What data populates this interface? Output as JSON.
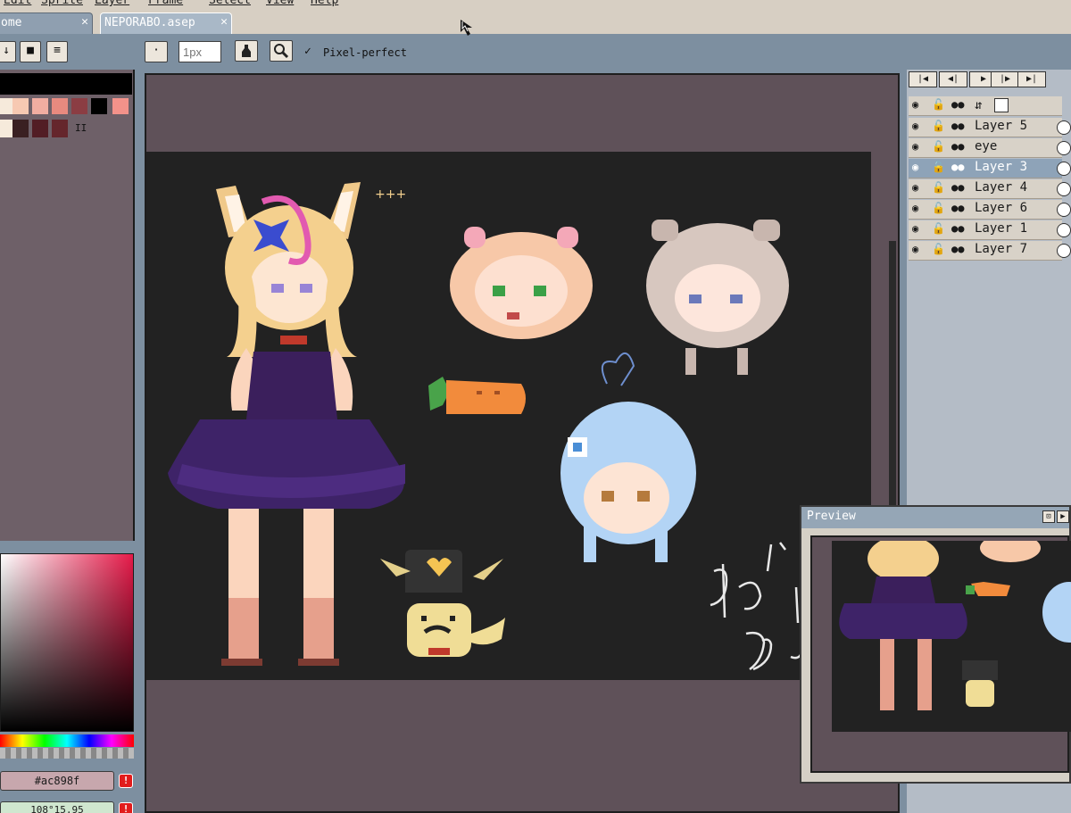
{
  "menu": [
    "Edit",
    "Sprite",
    "Layer",
    "Frame",
    "Select",
    "View",
    "Help"
  ],
  "tabs": [
    {
      "label": "ome",
      "close": "✕"
    },
    {
      "label": "NEPORABO.asep",
      "close": "✕"
    }
  ],
  "left_toolbar": {
    "down": "↓",
    "square": "■",
    "menu": "≡"
  },
  "context_bar": {
    "dot": "·",
    "brush_size_placeholder": "1px",
    "pixel_perfect_check": "✓",
    "pixel_perfect_label": "Pixel-perfect"
  },
  "palette": {
    "colors": [
      "#000000",
      "#f6eadb",
      "#f7c9b2",
      "#f1ada1",
      "#e88a7f",
      "#c0655e",
      "#8b3d43",
      "#000000",
      "#f3928a",
      "#3a2022",
      "#521d25",
      "#65262c",
      "#2b1113",
      "#4b1d22"
    ],
    "more_marker": "II"
  },
  "color_editor": {
    "hex": "#ac898f",
    "hsv": "108°15,95",
    "warning": "!"
  },
  "playback": [
    "|◀",
    "◀|",
    "▶",
    "|▶",
    "▶|"
  ],
  "layers": [
    {
      "name": "Layer 5",
      "selected": false
    },
    {
      "name": "eye",
      "selected": false
    },
    {
      "name": "Layer 3",
      "selected": true
    },
    {
      "name": "Layer 4",
      "selected": false
    },
    {
      "name": "Layer 6",
      "selected": false
    },
    {
      "name": "Layer 1",
      "selected": false
    },
    {
      "name": "Layer 7",
      "selected": false
    }
  ],
  "layer_icons": {
    "visible": "◉",
    "lock": "🔒",
    "cont": "●●"
  },
  "preview": {
    "title": "Preview",
    "btn_full": "⊡",
    "btn_play": "▶"
  },
  "canvas_text": {
    "sparkle": "+++"
  }
}
